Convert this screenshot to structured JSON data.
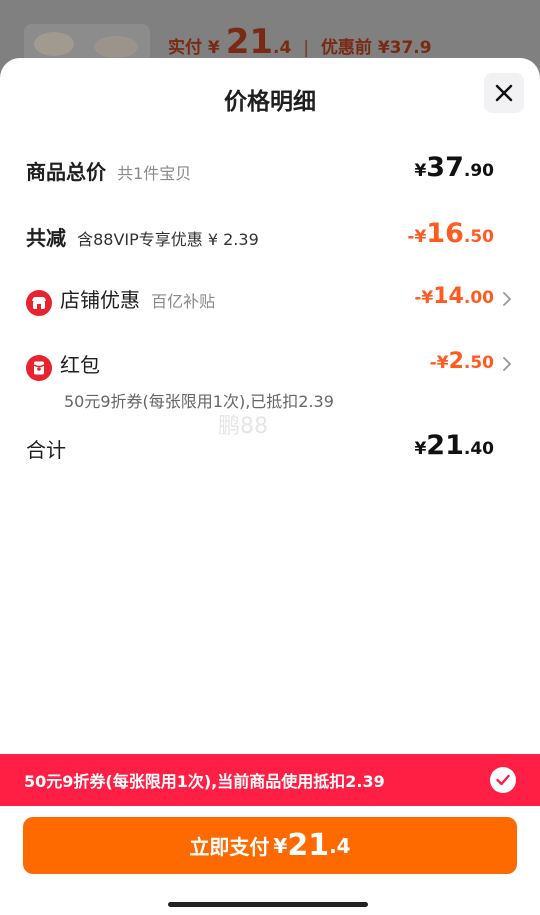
{
  "backdrop": {
    "paid_label": "实付",
    "currency": "¥",
    "paid_int": "21",
    "paid_dec": ".4",
    "divider": "|",
    "before_label": "优惠前",
    "before_value": "¥37.9"
  },
  "sheet": {
    "title": "价格明细"
  },
  "rows": {
    "total": {
      "label": "商品总价",
      "sub": "共1件宝贝",
      "sym": "¥",
      "int": "37",
      "dec": ".90"
    },
    "discount": {
      "label": "共减",
      "sub": "含88VIP专享优惠 ¥ 2.39",
      "sym": "-¥",
      "int": "16",
      "dec": ".50"
    },
    "store": {
      "label": "店铺优惠",
      "sub": "百亿补贴",
      "sym": "-¥",
      "int": "14",
      "dec": ".00"
    },
    "redpacket": {
      "label": "红包",
      "sym": "-¥",
      "int": "2",
      "dec": ".50",
      "desc": "50元9折券(每张限用1次),已抵扣2.39"
    },
    "sum": {
      "label": "合计",
      "sym": "¥",
      "int": "21",
      "dec": ".40"
    }
  },
  "watermark": "鹏88",
  "coupon_bar": {
    "text": "50元9折券(每张限用1次),当前商品使用抵扣2.39"
  },
  "pay_button": {
    "label": "立即支付",
    "sym": "¥",
    "int": "21",
    "dec": ".4"
  },
  "colors": {
    "accent_orange": "#ff6a00",
    "discount_orange": "#ff5a1f",
    "coupon_red": "#ff1e44"
  }
}
